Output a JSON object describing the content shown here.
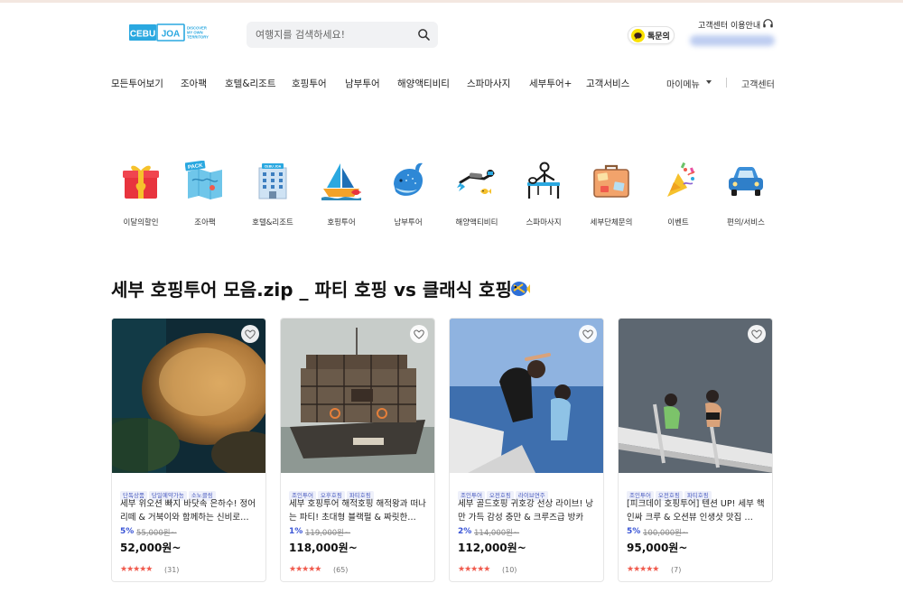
{
  "header": {
    "logo": {
      "part1": "CEBU",
      "part2": "JOA",
      "tagline": [
        "DISCOVER",
        "MY OWN",
        "TERRITORY"
      ]
    },
    "search": {
      "placeholder": "여행지를 검색하세요!"
    },
    "kakao_label": "톡문의",
    "cs_info_label": "고객센터 이용안내"
  },
  "nav": {
    "items": [
      "모든투어보기",
      "조아팩",
      "호텔&리조트",
      "호핑투어",
      "남부투어",
      "해양액티비티",
      "스파마사지",
      "세부투어+",
      "고객서비스"
    ],
    "my_menu": "마이메뉴",
    "customer_center": "고객센터"
  },
  "categories": [
    {
      "label": "이달의할인",
      "icon": "gift-box-icon"
    },
    {
      "label": "조아팩",
      "icon": "pack-map-icon",
      "badge": "PACK"
    },
    {
      "label": "호텔&리조트",
      "icon": "hotel-building-icon",
      "badge": "CEBU JOA"
    },
    {
      "label": "호핑투어",
      "icon": "sailboat-icon"
    },
    {
      "label": "남부투어",
      "icon": "whale-shark-icon"
    },
    {
      "label": "해양액티비티",
      "icon": "diver-icon"
    },
    {
      "label": "스파마사지",
      "icon": "massage-icon"
    },
    {
      "label": "세부단체문의",
      "icon": "suitcase-icon"
    },
    {
      "label": "이벤트",
      "icon": "party-popper-icon"
    },
    {
      "label": "편의/서비스",
      "icon": "car-icon"
    }
  ],
  "section": {
    "title": "세부 호핑투어 모음.zip _ 파티 호핑 vs 클래식 호핑"
  },
  "cards": [
    {
      "tags": [
        "단독상품",
        "당일예약가능",
        "소노클링"
      ],
      "title": "세부 위오션 빠지 바닷속 은하수! 정어리떼 & 거북이와 함께하는 신비로…",
      "discount": "5%",
      "original_price": "55,000원~",
      "price": "52,000원~",
      "stars": "★★★★★",
      "rating": 5,
      "reviews": "(31)"
    },
    {
      "tags": [
        "조인투어",
        "오후호핑",
        "파티호핑"
      ],
      "title": "세부 호핑투어 해적호핑 해적왕과 떠나는 파티! 초대형 블랙펄 & 짜릿한…",
      "discount": "1%",
      "original_price": "119,000원~",
      "price": "118,000원~",
      "stars": "★★★★★",
      "rating": 5,
      "reviews": "(65)"
    },
    {
      "tags": [
        "조인투어",
        "오전호핑",
        "라이브연주"
      ],
      "title": "세부 골드호핑 귀호강 선상 라이브! 낭만 가득 감성 충만 & 크루즈급 방카",
      "discount": "2%",
      "original_price": "114,000원~",
      "price": "112,000원~",
      "stars": "★★★★★",
      "rating": 5,
      "reviews": "(10)"
    },
    {
      "tags": [
        "조인투어",
        "오전호핑",
        "파티호핑"
      ],
      "title": "[피크데이 호핑투어] 텐션 UP! 세부 핵인싸 크루 & 오션뷰 인생샷 맛집 …",
      "discount": "5%",
      "original_price": "100,000원~",
      "price": "95,000원~",
      "stars": "★★★★★",
      "rating": 5,
      "reviews": "(7)"
    }
  ]
}
